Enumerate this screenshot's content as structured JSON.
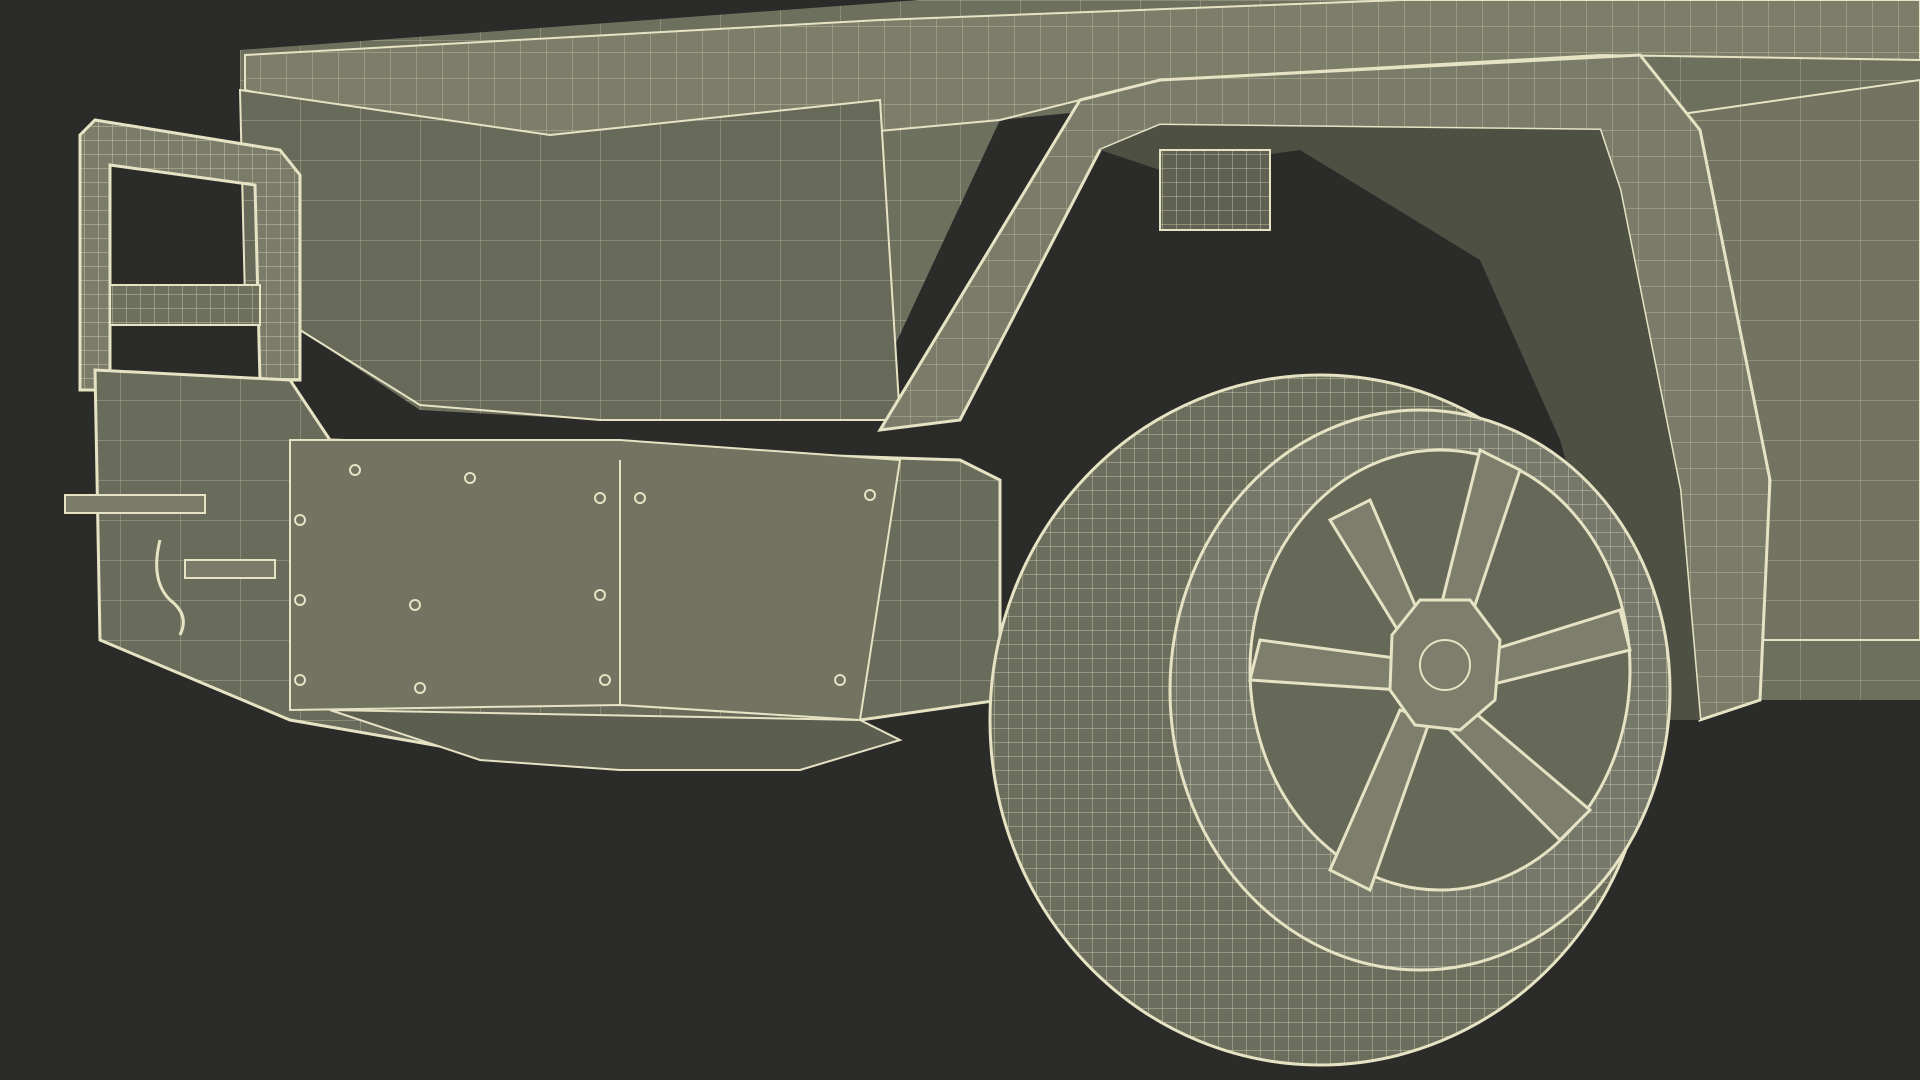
{
  "scene": {
    "subject": "wireframe-render-armored-vehicle-front-wheel",
    "colors": {
      "background": "#2b2b29",
      "surface": "#737563",
      "surface_dark": "#5f6152",
      "surface_light": "#8a8c78",
      "wire": "#e6e3c4",
      "wire_soft": "#c9c7a9"
    }
  }
}
